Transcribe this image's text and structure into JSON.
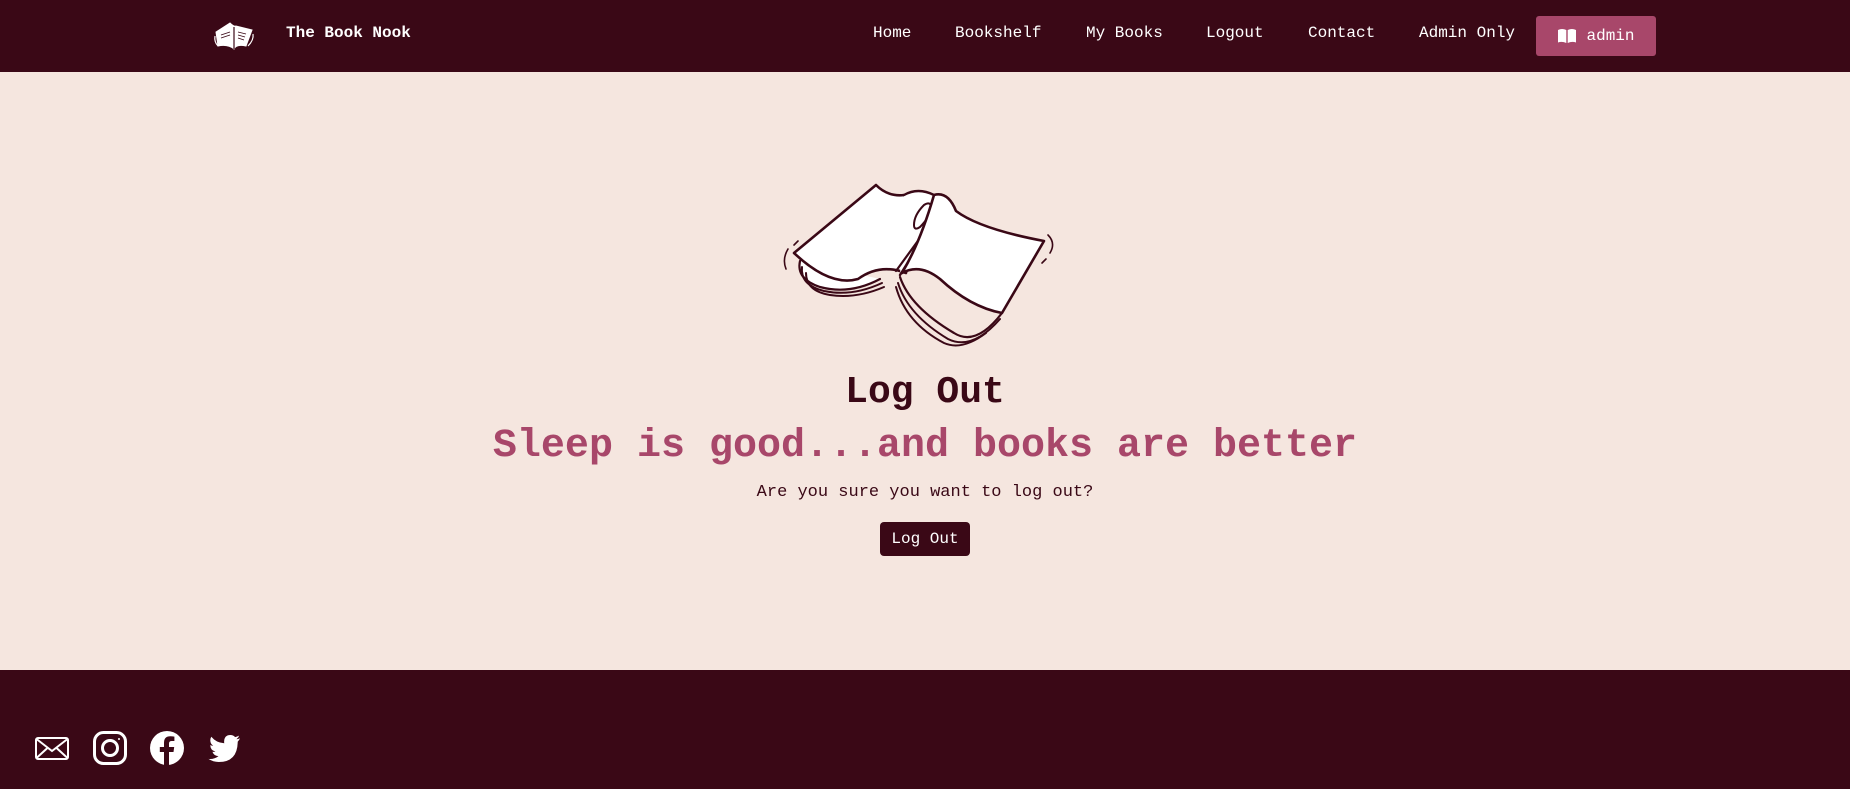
{
  "header": {
    "brand_name": "The Book Nook",
    "logo_icon": "open-book-logo-icon",
    "nav": [
      {
        "label": "Home"
      },
      {
        "label": "Bookshelf"
      },
      {
        "label": "My Books"
      },
      {
        "label": "Logout"
      },
      {
        "label": "Contact"
      },
      {
        "label": "Admin Only"
      }
    ],
    "user_button": {
      "icon": "book-icon",
      "label": "admin"
    }
  },
  "main": {
    "illustration_icon": "open-book-illustration",
    "title": "Log Out",
    "tagline": "Sleep is good...and books are better",
    "confirm_text": "Are you sure you want to log out?",
    "logout_button_label": "Log Out"
  },
  "footer": {
    "social_icons": [
      "mail-icon",
      "instagram-icon",
      "facebook-icon",
      "twitter-icon"
    ]
  },
  "colors": {
    "primary_dark": "#3a0816",
    "accent": "#a8476a",
    "background": "#f5e6df",
    "text_light": "#ffffff"
  }
}
